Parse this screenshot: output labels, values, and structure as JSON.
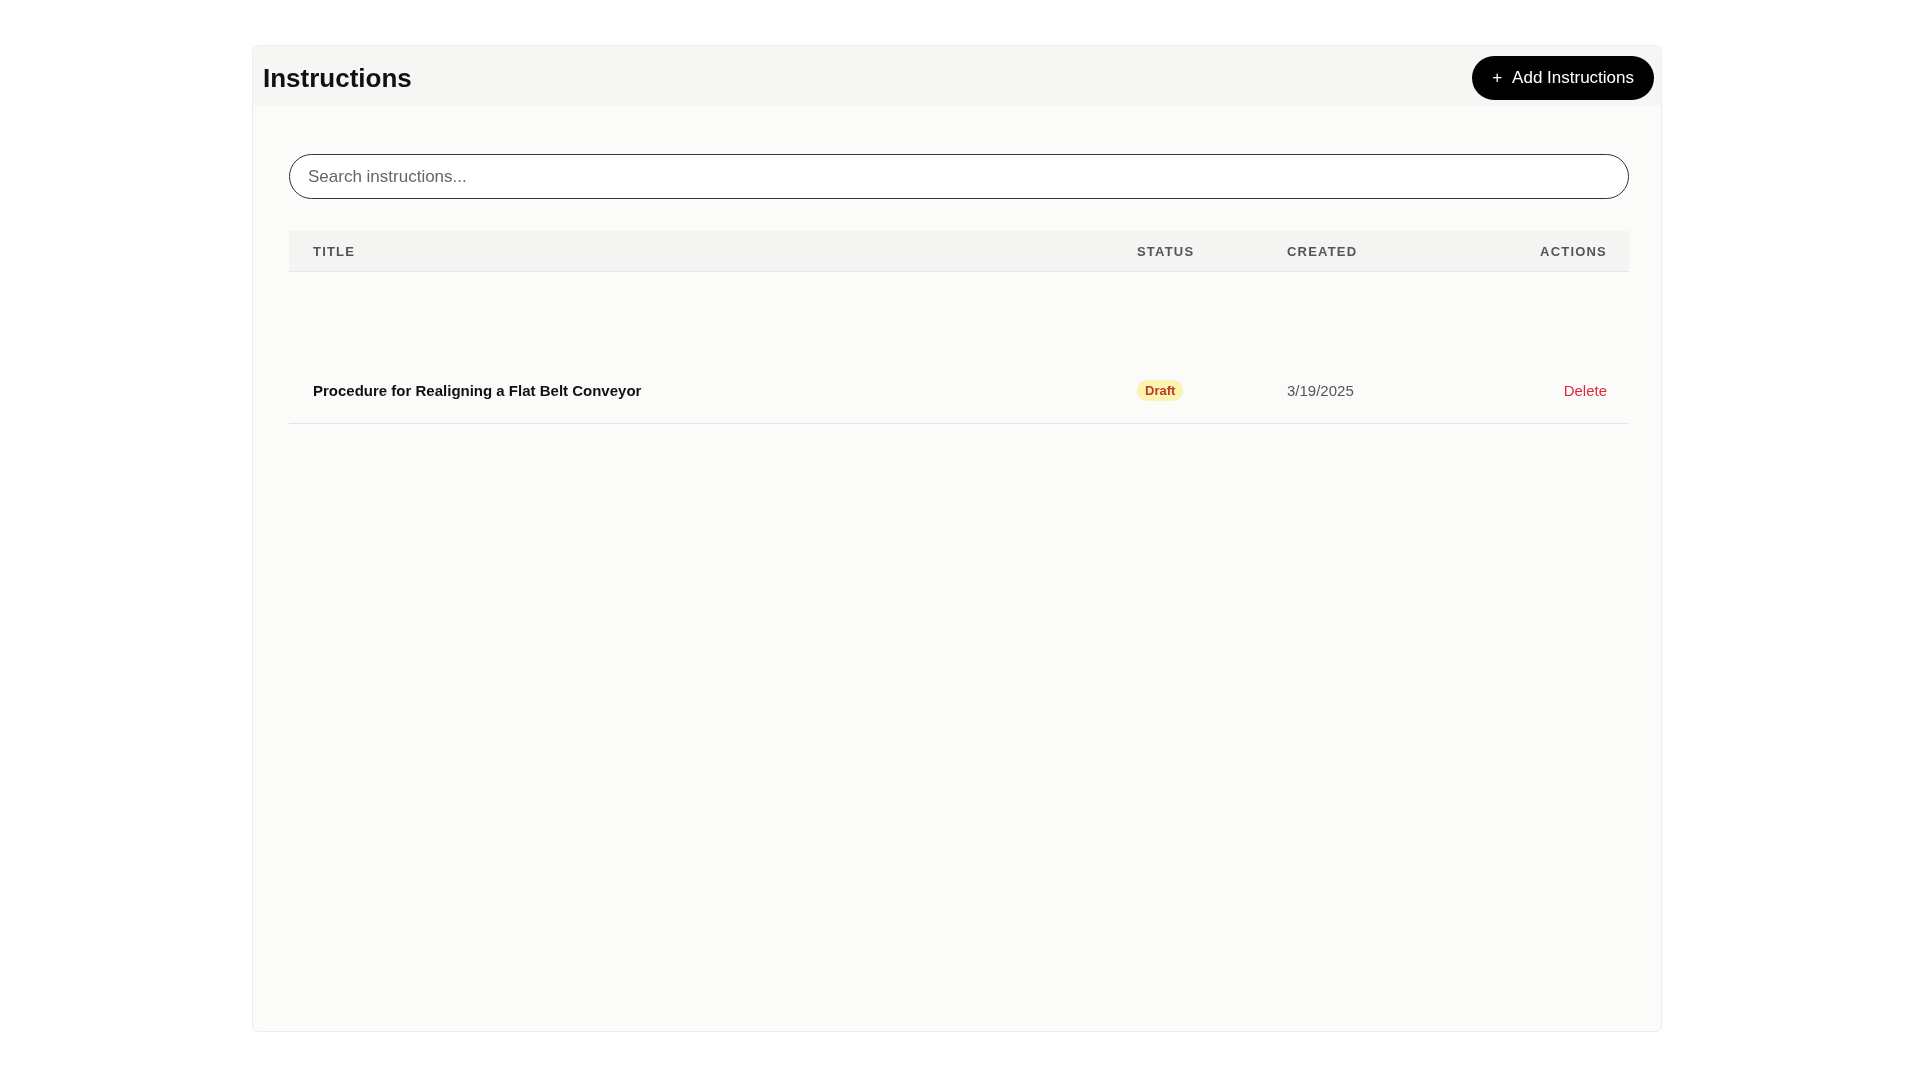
{
  "header": {
    "title": "Instructions",
    "add_button": {
      "icon": "+",
      "label": "Add Instructions"
    }
  },
  "search": {
    "placeholder": "Search instructions..."
  },
  "table": {
    "columns": [
      "TITLE",
      "STATUS",
      "CREATED",
      "ACTIONS"
    ],
    "rows": [
      {
        "title": "Procedure for Realigning a Flat Belt Conveyor",
        "status": "Draft",
        "created": "3/19/2025",
        "action": "Delete"
      }
    ]
  }
}
